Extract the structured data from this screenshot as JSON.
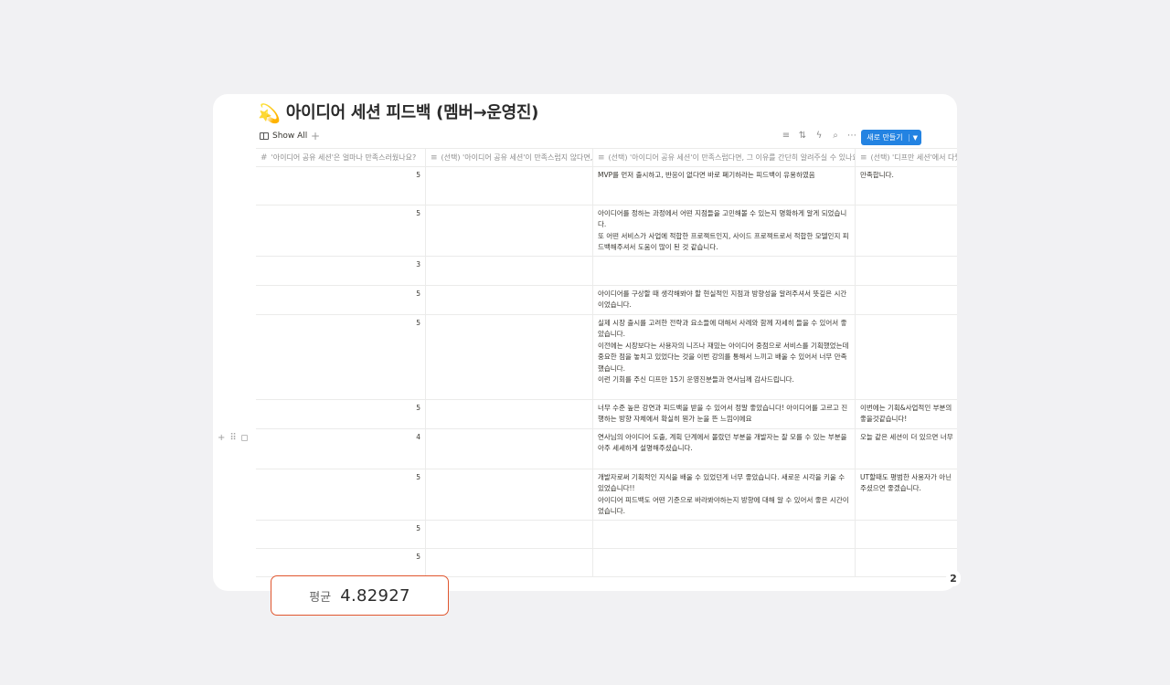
{
  "page": {
    "title_emoji": "💫",
    "title": "아이디어 세션 피드백 (멤버→운영진)"
  },
  "toolbar": {
    "view_label": "Show All",
    "add_view": "+",
    "new_button": "새로 만들기"
  },
  "columns": [
    {
      "icon": "#",
      "label": "'아이디어 공유 세션'은 얼마나 만족스러웠나요?"
    },
    {
      "icon": "≡",
      "label": "(선택) '아이디어 공유 세션'이 만족스럽지 않다면, 그 이유를 간단히 알려주실 수 있나요?"
    },
    {
      "icon": "≡",
      "label": "(선택) '아이디어 공유 세션'이 만족스럽다면, 그 이유를 간단히 알려주실 수 있나요?"
    },
    {
      "icon": "≡",
      "label": "(선택) '디프만 세션'에서 다뤘으면 하는 주제가 있나요?"
    }
  ],
  "rows": [
    {
      "score": "5",
      "reason_bad": "",
      "reason_good": "MVP를 먼저 출시하고, 반응이 없다면 바로 폐기하라는 피드백이 유용하였음",
      "topic": "만족합니다."
    },
    {
      "score": "5",
      "reason_bad": "",
      "reason_good": "아이디어를 정하는 과정에서 어떤 지점들을 고민해볼 수 있는지 명확하게 알게 되었습니다.\n또 어떤 서비스가 사업에 적합한 프로젝트인지, 사이드 프로젝트로서 적합한 모델인지 피드백해주셔서 도움이 많이 된 것 같습니다.",
      "topic": ""
    },
    {
      "score": "3",
      "reason_bad": "",
      "reason_good": "",
      "topic": ""
    },
    {
      "score": "5",
      "reason_bad": "",
      "reason_good": "아이디어를 구상할 때 생각해봐야 할 현실적인 지점과 방향성을 알려주셔서 뜻깊은 시간이었습니다.",
      "topic": ""
    },
    {
      "score": "5",
      "reason_bad": "",
      "reason_good": "실제 시장 출시를 고려한 전략과 요소들에 대해서 사례와 함께 자세히 들을 수 있어서 좋았습니다.\n이전에는 시장보다는 사용자의 니즈나 재밌는 아이디어 중점으로 서비스를 기획했었는데\n중요한 점을 놓치고 있었다는 것을 이번 강의를 통해서 느끼고 배울 수 있어서 너무 만족했습니다.\n이런 기회를 주신 디프만 15기 운영진분들과 연사님께 감사드립니다.",
      "topic": ""
    },
    {
      "score": "5",
      "reason_bad": "",
      "reason_good": "너무 수준 높은 강연과 피드백을 받을 수 있어서 정말 좋았습니다! 아이디어를 고르고 진행하는 방향 자체에서 확실히 뭔가 눈을 뜬 느낌이에요",
      "topic": "이번에는 기획&사업적인 부분의\n좋을것같습니다!"
    },
    {
      "score": "4",
      "reason_bad": "",
      "reason_good": "연사님의 아이디어 도출, 계획 단계에서 몰랐던 부분을 개발자는 잘 모를 수 있는 부분을 아주 세세하게 설명해주셨습니다.",
      "topic": "오늘 같은 세션이 더 있으면 너무"
    },
    {
      "score": "5",
      "reason_bad": "",
      "reason_good": "개발자로써 기획적인 지식을 배울 수 있었던게 너무 좋았습니다. 새로운 시각을 키울 수 있었습니다!!\n아이디어 피드백도 어떤 기준으로 바라봐야하는지 방향에 대해 알 수 있어서 좋은 시간이었습니다.",
      "topic": "UT할때도 평범한 사용자가 아닌\n주셨으면 좋겠습니다."
    },
    {
      "score": "5",
      "reason_bad": "",
      "reason_good": "",
      "topic": ""
    },
    {
      "score": "5",
      "reason_bad": "",
      "reason_good": "",
      "topic": ""
    }
  ],
  "summary": {
    "label": "평균",
    "value": "4.82927"
  },
  "page_indicator": "2"
}
